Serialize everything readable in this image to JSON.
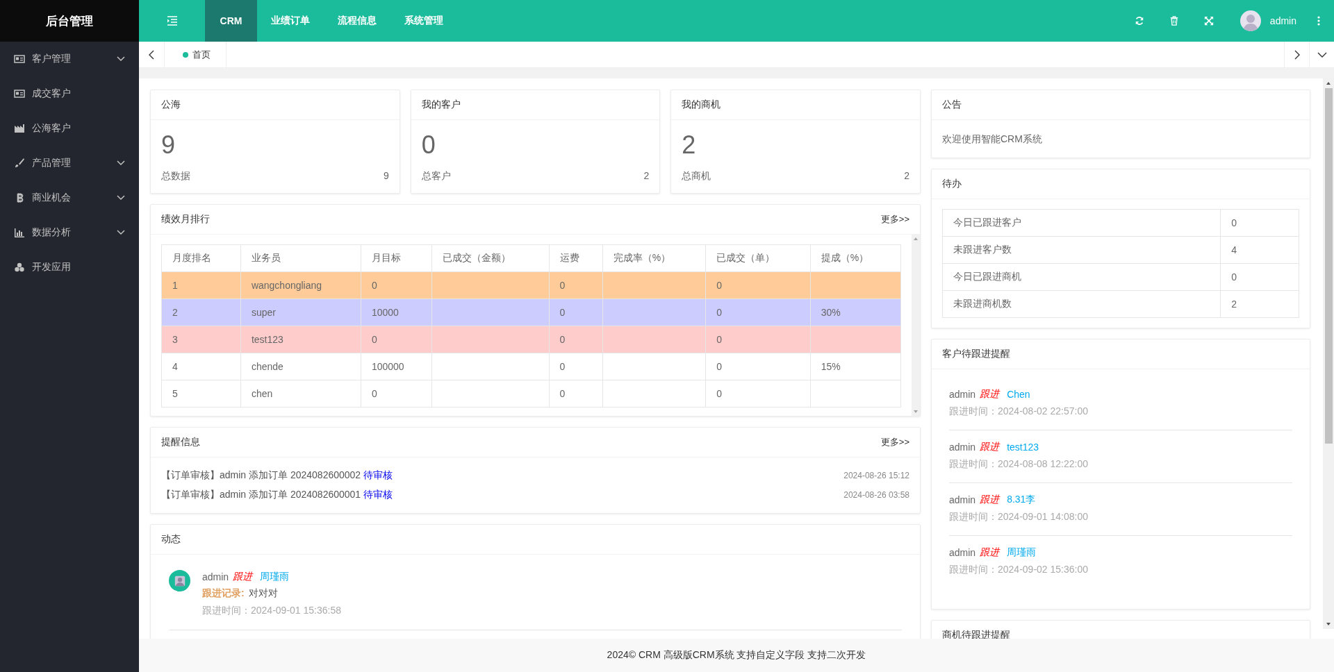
{
  "sidebar": {
    "logo": "后台管理",
    "items": [
      {
        "label": "客户管理",
        "kind": "group"
      },
      {
        "label": "成交客户",
        "kind": "link"
      },
      {
        "label": "公海客户",
        "kind": "link"
      },
      {
        "label": "产品管理",
        "kind": "group"
      },
      {
        "label": "商业机会",
        "kind": "group"
      },
      {
        "label": "数据分析",
        "kind": "group"
      },
      {
        "label": "开发应用",
        "kind": "link"
      }
    ]
  },
  "topbar": {
    "nav": [
      {
        "label": "CRM",
        "selected": true
      },
      {
        "label": "业绩订单",
        "selected": false
      },
      {
        "label": "流程信息",
        "selected": false
      },
      {
        "label": "系统管理",
        "selected": false
      }
    ],
    "user": "admin"
  },
  "tabs": [
    {
      "label": "首页",
      "selected": true
    }
  ],
  "stats": [
    {
      "title": "公海",
      "value": "9",
      "caption": "总数据",
      "count": "9"
    },
    {
      "title": "我的客户",
      "value": "0",
      "caption": "总客户",
      "count": "2"
    },
    {
      "title": "我的商机",
      "value": "2",
      "caption": "总商机",
      "count": "2"
    }
  ],
  "ranking": {
    "title": "绩效月排行",
    "more": "更多>>",
    "columns": [
      "月度排名",
      "业务员",
      "月目标",
      "已成交（金额）",
      "运费",
      "完成率（%）",
      "已成交（单）",
      "提成（%）"
    ],
    "rows": [
      {
        "color": "#ffcc99",
        "cells": [
          "1",
          "wangchongliang",
          "0",
          "",
          "0",
          "",
          "0",
          ""
        ]
      },
      {
        "color": "#ccccff",
        "cells": [
          "2",
          "super",
          "10000",
          "",
          "0",
          "",
          "0",
          "30%"
        ]
      },
      {
        "color": "#ffcccc",
        "cells": [
          "3",
          "test123",
          "0",
          "",
          "0",
          "",
          "0",
          ""
        ]
      },
      {
        "cells": [
          "4",
          "chende",
          "100000",
          "",
          "0",
          "",
          "0",
          "15%"
        ]
      },
      {
        "cells": [
          "5",
          "chen",
          "0",
          "",
          "0",
          "",
          "0",
          ""
        ]
      }
    ]
  },
  "reminders": {
    "title": "提醒信息",
    "more": "更多>>",
    "items": [
      {
        "text": "【订单审核】admin 添加订单 2024082600002",
        "status": "待审核",
        "time": "2024-08-26 15:12"
      },
      {
        "text": "【订单审核】admin 添加订单 2024082600001",
        "status": "待审核",
        "time": "2024-08-26 03:58"
      }
    ]
  },
  "activity": {
    "title": "动态",
    "items": [
      {
        "user": "admin",
        "action": "跟进",
        "target": "周瑾雨",
        "record_label": "跟进记录:",
        "record": "对对对",
        "time_label": "跟进时间：",
        "time": "2024-09-01 15:36:58"
      }
    ]
  },
  "notice": {
    "title": "公告",
    "text": "欢迎使用智能CRM系统"
  },
  "todo": {
    "title": "待办",
    "rows": [
      {
        "label": "今日已跟进客户",
        "value": "0"
      },
      {
        "label": "未跟进客户数",
        "value": "4"
      },
      {
        "label": "今日已跟进商机",
        "value": "0"
      },
      {
        "label": "未跟进商机数",
        "value": "2"
      }
    ]
  },
  "customer_followups": {
    "title": "客户待跟进提醒",
    "items": [
      {
        "user": "admin",
        "action": "跟进",
        "target": "Chen",
        "time_label": "跟进时间：",
        "time": "2024-08-02 22:57:00"
      },
      {
        "user": "admin",
        "action": "跟进",
        "target": "test123",
        "time_label": "跟进时间：",
        "time": "2024-08-08 12:22:00"
      },
      {
        "user": "admin",
        "action": "跟进",
        "target": "8.31李",
        "time_label": "跟进时间：",
        "time": "2024-09-01 14:08:00"
      },
      {
        "user": "admin",
        "action": "跟进",
        "target": "周瑾雨",
        "time_label": "跟进时间：",
        "time": "2024-09-02 15:36:00"
      }
    ]
  },
  "opportunity_followups": {
    "title": "商机待跟进提醒"
  },
  "footer": "2024© CRM 高级版CRM系统 支持自定义字段 支持二次开发"
}
